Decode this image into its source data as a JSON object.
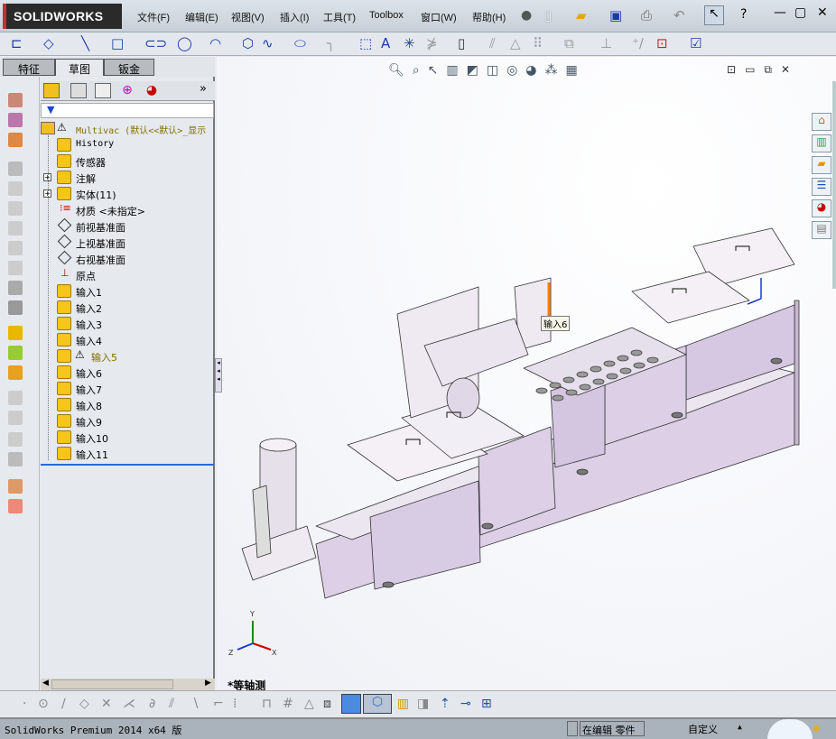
{
  "app": {
    "logo": "SOLIDWORKS"
  },
  "menu": [
    "文件(F)",
    "编辑(E)",
    "视图(V)",
    "插入(I)",
    "工具(T)",
    "Toolbox",
    "窗口(W)",
    "帮助(H)"
  ],
  "tabs": [
    {
      "label": "特征"
    },
    {
      "label": "草图",
      "active": true
    },
    {
      "label": "钣金"
    }
  ],
  "tree": {
    "root": "Multivac  (默认<<默认>_显示",
    "items": [
      {
        "label": "History",
        "icon": "history-icon"
      },
      {
        "label": "传感器",
        "icon": "sensor-icon"
      },
      {
        "label": "注解",
        "icon": "annotation-icon",
        "expandable": true
      },
      {
        "label": "实体(11)",
        "icon": "solid-bodies-icon",
        "expandable": true
      },
      {
        "label": "材质 <未指定>",
        "icon": "material-icon"
      },
      {
        "label": "前视基准面",
        "icon": "plane-icon"
      },
      {
        "label": "上视基准面",
        "icon": "plane-icon"
      },
      {
        "label": "右视基准面",
        "icon": "plane-icon"
      },
      {
        "label": "原点",
        "icon": "origin-icon"
      },
      {
        "label": "输入1",
        "icon": "import-icon"
      },
      {
        "label": "输入2",
        "icon": "import-icon"
      },
      {
        "label": "输入3",
        "icon": "import-icon"
      },
      {
        "label": "输入4",
        "icon": "import-icon"
      },
      {
        "label": "输入5",
        "icon": "import-icon",
        "warning": true
      },
      {
        "label": "输入6",
        "icon": "import-icon"
      },
      {
        "label": "输入7",
        "icon": "import-icon"
      },
      {
        "label": "输入8",
        "icon": "import-icon"
      },
      {
        "label": "输入9",
        "icon": "import-icon"
      },
      {
        "label": "输入10",
        "icon": "import-icon"
      },
      {
        "label": "输入11",
        "icon": "import-icon"
      }
    ]
  },
  "viewport": {
    "tooltip": "输入6",
    "view_name": "*等轴测",
    "triad": {
      "x": "X",
      "y": "Y",
      "z": "Z"
    }
  },
  "status": {
    "product": "SolidWorks Premium 2014 x64 版",
    "mode": "在编辑 零件",
    "units": "自定义"
  },
  "colors": {
    "model": "#dcd0e4",
    "logo_red": "#c8302a",
    "selection": "#ff8000"
  }
}
